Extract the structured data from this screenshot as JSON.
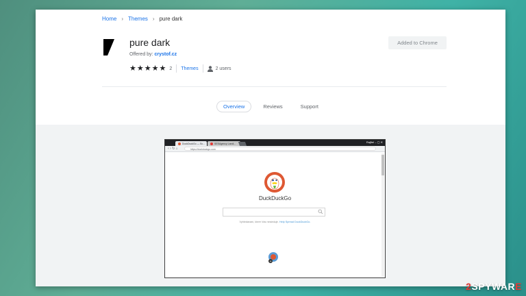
{
  "breadcrumb": {
    "home": "Home",
    "sep": "›",
    "category": "Themes",
    "current": "pure dark"
  },
  "extension": {
    "title": "pure dark",
    "offered_prefix": "Offered by:",
    "offered_by": "crystof.cz",
    "rating_stars": 5,
    "rating_count": "2",
    "category": "Themes",
    "users": "2 users",
    "action_button": "Added to Chrome"
  },
  "tabs": [
    {
      "label": "Overview",
      "active": true
    },
    {
      "label": "Reviews",
      "active": false
    },
    {
      "label": "Support",
      "active": false
    }
  ],
  "screenshot": {
    "tab1": "DuckDuckGo — Sc...",
    "tab2": "SESAgency Landi...",
    "profile": "Rajfiel",
    "url": "https://duckduckgo.com",
    "brand": "DuckDuckGo",
    "tagline_text": "Vyhledávání, které Vás nesleduje.",
    "tagline_link": "Help Spread DuckDuckGo."
  },
  "watermark": {
    "digit": "2",
    "text": "SPYWAR",
    "suffix": "E"
  },
  "colors": {
    "accent": "#1a73e8",
    "ddg_orange": "#de5833",
    "bg_teal": "#3fb2a6"
  }
}
